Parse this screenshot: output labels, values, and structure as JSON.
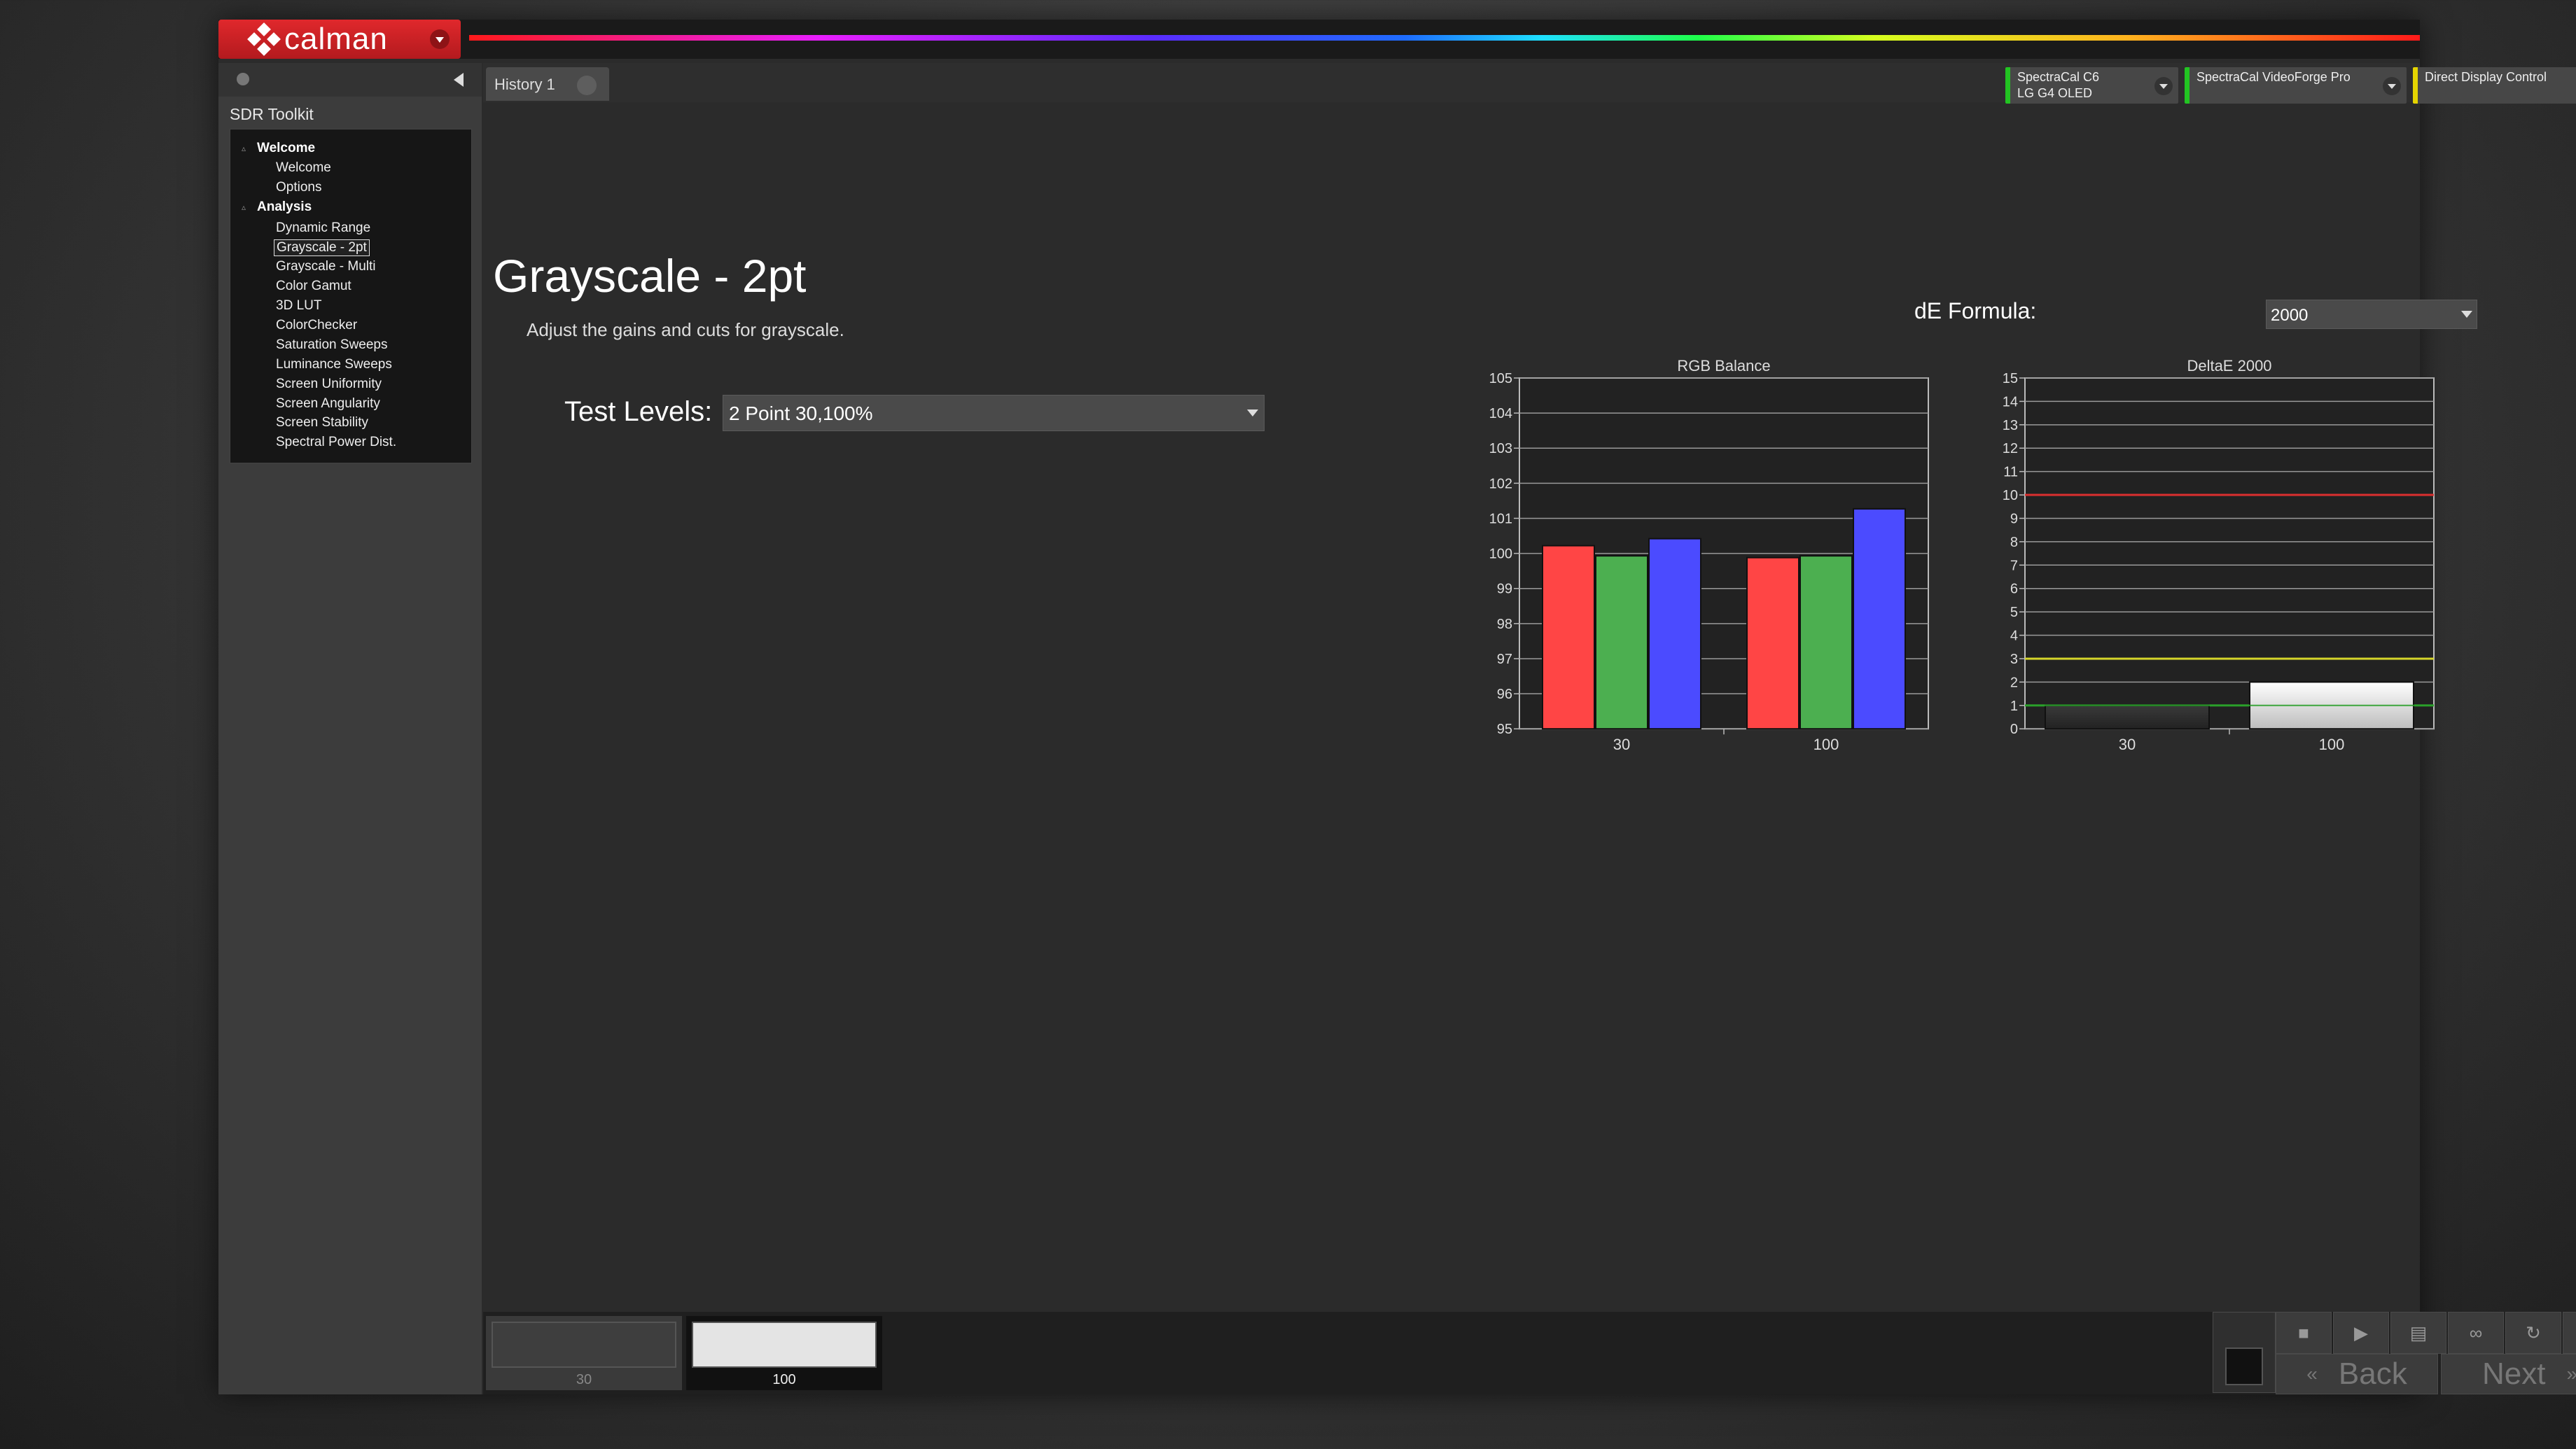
{
  "app": {
    "logo_text": "calman",
    "sidebar_title": "SDR Toolkit"
  },
  "sidebar": {
    "groups": [
      {
        "label": "Welcome",
        "items": [
          "Welcome",
          "Options"
        ]
      },
      {
        "label": "Analysis",
        "items": [
          "Dynamic Range",
          "Grayscale - 2pt",
          "Grayscale - Multi",
          "Color Gamut",
          "3D LUT",
          "ColorChecker",
          "Saturation Sweeps",
          "Luminance Sweeps",
          "Screen Uniformity",
          "Screen Angularity",
          "Screen Stability",
          "Spectral Power Dist."
        ]
      }
    ],
    "selected": "Grayscale - 2pt"
  },
  "tabs": {
    "history": "History 1"
  },
  "devices": [
    {
      "line1": "SpectraCal C6",
      "line2": "LG G4 OLED",
      "status_color": "#22c422"
    },
    {
      "line1": "SpectraCal VideoForge Pro",
      "line2": "",
      "status_color": "#22c422"
    },
    {
      "line1": "Direct Display Control",
      "line2": "",
      "status_color": "#e5d400"
    }
  ],
  "page": {
    "title": "Grayscale - 2pt",
    "description": "Adjust the gains and cuts for grayscale.",
    "test_levels_label": "Test Levels:",
    "test_levels_value": "2 Point 30,100%",
    "de_formula_label": "dE Formula:",
    "de_formula_value": "2000"
  },
  "chart_data": [
    {
      "type": "bar",
      "title": "RGB Balance",
      "categories": [
        "30",
        "100"
      ],
      "series": [
        {
          "color": "#ff4545",
          "values": [
            100.22,
            99.88
          ]
        },
        {
          "color": "#4caf50",
          "values": [
            99.93,
            99.93
          ]
        },
        {
          "color": "#4b4bff",
          "values": [
            100.42,
            101.27
          ]
        }
      ],
      "ylim": [
        95,
        105
      ],
      "yticks": [
        95,
        96,
        97,
        98,
        99,
        100,
        101,
        102,
        103,
        104,
        105
      ],
      "grid": true
    },
    {
      "type": "bar",
      "title": "DeltaE 2000",
      "categories": [
        "30",
        "100"
      ],
      "values": [
        1.0,
        2.0
      ],
      "bar_colors": [
        "#3a3a3a",
        "#ffffff"
      ],
      "ylim": [
        0,
        15
      ],
      "yticks": [
        0,
        1,
        2,
        3,
        4,
        5,
        6,
        7,
        8,
        9,
        10,
        11,
        12,
        13,
        14,
        15
      ],
      "reference_lines": [
        {
          "value": 10,
          "color": "#d93030"
        },
        {
          "value": 3,
          "color": "#d6d62a"
        },
        {
          "value": 1,
          "color": "#2aa02a"
        }
      ],
      "grid": true
    }
  ],
  "bottom": {
    "patches": [
      {
        "label": "30",
        "color": "#3e3e3e"
      },
      {
        "label": "100",
        "color": "#e4e4e4"
      }
    ],
    "back_label": "Back",
    "next_label": "Next"
  }
}
